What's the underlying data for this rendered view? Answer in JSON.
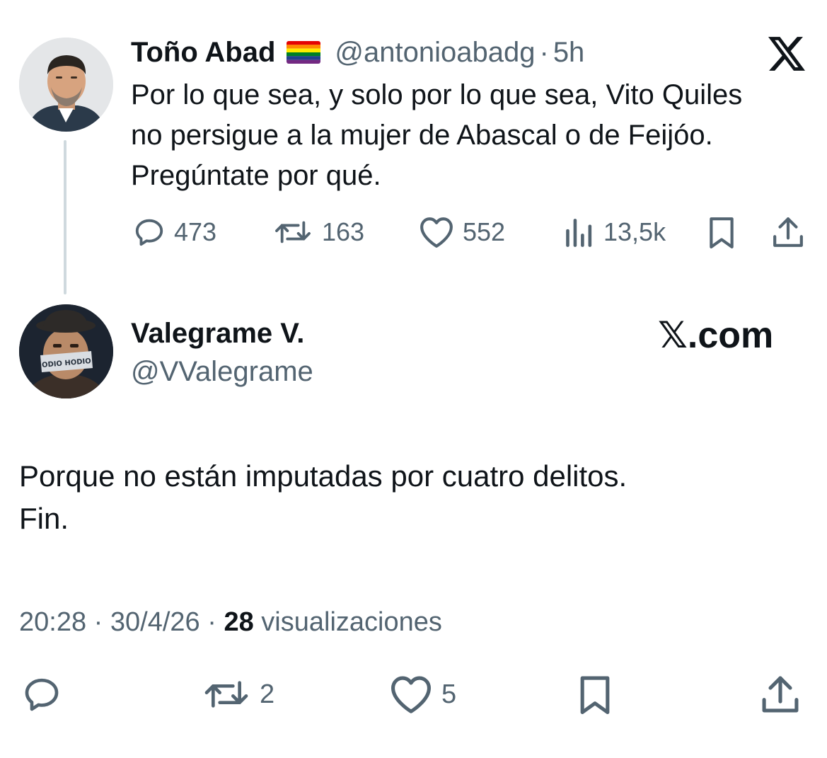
{
  "original_tweet": {
    "author_name": "Toño Abad",
    "author_flag": "🏳️‍🌈",
    "handle": "@antonioabadg",
    "separator": "·",
    "time_ago": "5h",
    "text_lines": [
      "Por lo que sea, y solo por lo que sea, Vito Quiles",
      "no persigue a la mujer de Abascal o de Feijóo.",
      "Pregúntate por qué."
    ],
    "stats": {
      "replies": "473",
      "reposts": "163",
      "likes": "552",
      "views": "13,5k"
    },
    "brand_icon": "x-logo-icon"
  },
  "reply_tweet": {
    "author_name": "Valegrame V.",
    "handle": "@VValegrame",
    "brand_label": "𝕏.com",
    "avatar_mask_text": "ODIO HODIO",
    "text_lines": [
      "Porque no están imputadas por cuatro delitos.",
      "Fin."
    ],
    "meta": {
      "time": "20:28",
      "sep1": "·",
      "date": "30/4/26",
      "sep2": "·",
      "views_count": "28",
      "views_label": "visualizaciones"
    },
    "actions": {
      "reposts": "2",
      "likes": "5"
    }
  },
  "colors": {
    "text": "#0f1419",
    "secondary": "#536471",
    "thread_line": "#cfd9de"
  }
}
